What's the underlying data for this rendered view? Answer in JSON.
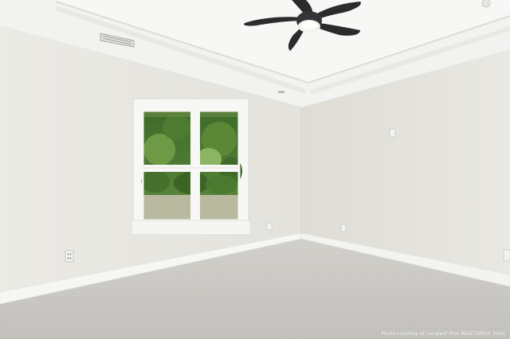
{
  "scene": {
    "description_free": true,
    "watermark_text": "Photo courtesy of Longleaf Pine REALTORS® 2024"
  },
  "colors": {
    "ceiling": "#f3f3f1",
    "left_wall": "#e9e8e3",
    "right_wall": "#e5e4de",
    "carpet": "#c9c7c2",
    "trim": "#f6f6f4",
    "fan": "#2b2b2e",
    "foliage": "#4f7a35",
    "lawn": "#b7b89c"
  },
  "icons": {
    "ceiling_fan": "ceiling-fan-icon",
    "air_vent": "air-vent-icon",
    "outlet": "electrical-outlet-icon"
  }
}
